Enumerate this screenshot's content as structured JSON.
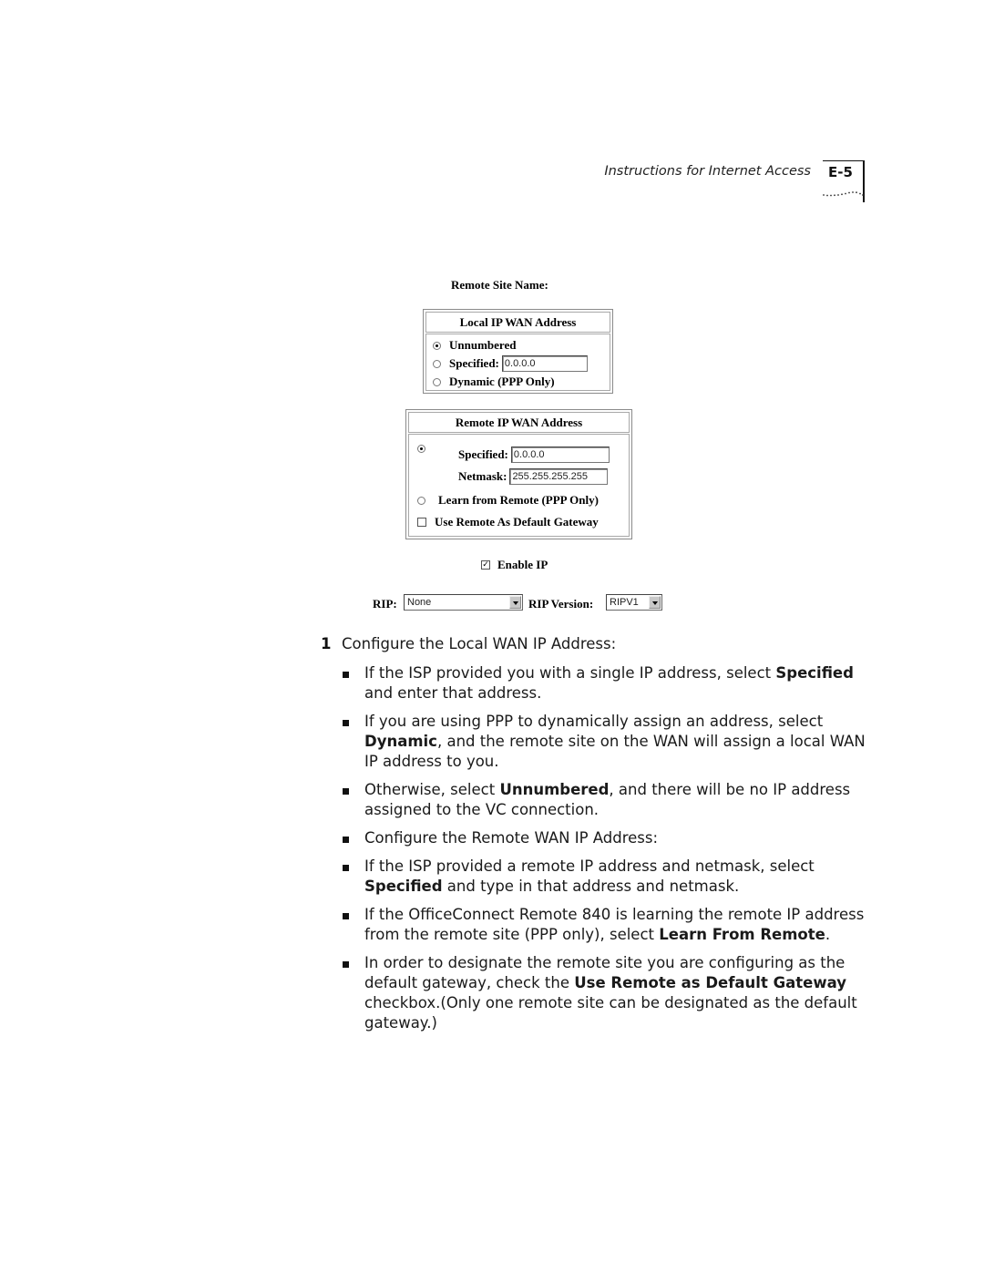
{
  "header": {
    "running_title": "Instructions for Internet Access",
    "page_number": "E-5"
  },
  "form": {
    "remote_site_name_label": "Remote Site Name:",
    "local_ip_wan": {
      "title": "Local IP WAN Address",
      "options": [
        {
          "label": "Unnumbered",
          "selected": true
        },
        {
          "label": "Specified:",
          "selected": false,
          "value": "0.0.0.0"
        },
        {
          "label": "Dynamic (PPP Only)",
          "selected": false
        }
      ]
    },
    "remote_ip_wan": {
      "title": "Remote IP WAN Address",
      "specified": {
        "label": "Specified:",
        "selected": true,
        "value": "0.0.0.0"
      },
      "netmask": {
        "label": "Netmask:",
        "value": "255.255.255.255"
      },
      "learn": {
        "label": "Learn from Remote (PPP Only)",
        "selected": false
      },
      "default_gateway": {
        "label": "Use Remote As Default Gateway",
        "checked": false
      }
    },
    "enable_ip": {
      "label": "Enable IP",
      "checked": true,
      "check_glyph": "✓"
    },
    "rip": {
      "label": "RIP:",
      "value": "None"
    },
    "rip_version": {
      "label": "RIP Version:",
      "value": "RIPV1"
    }
  },
  "body": {
    "step_number": "1",
    "step_text": "Configure the Local WAN IP Address:",
    "bullets": [
      {
        "parts": [
          "If the ISP provided you with a single IP address, select ",
          "Specified",
          " and enter that address."
        ]
      },
      {
        "parts": [
          "If you are using PPP to dynamically assign an address, select ",
          "Dynamic",
          ", and the remote site on the WAN will assign a local WAN IP address to you."
        ]
      },
      {
        "parts": [
          "Otherwise, select ",
          "Unnumbered",
          ", and there will be no IP address assigned to the VC connection."
        ]
      },
      {
        "parts": [
          "Configure the Remote WAN IP Address:",
          "",
          ""
        ]
      },
      {
        "parts": [
          "If the ISP provided a remote IP address and netmask, select ",
          "Specified",
          " and type in that address and netmask."
        ]
      },
      {
        "parts": [
          "If the OfficeConnect Remote 840 is learning the remote IP address from the remote site (PPP only), select ",
          "Learn From Remote",
          "."
        ]
      },
      {
        "parts": [
          "In order to designate the remote site you are configuring as the default gateway, check the ",
          "Use Remote as Default Gateway",
          " checkbox.(Only one remote site can be designated as the default gateway.)"
        ]
      }
    ]
  }
}
